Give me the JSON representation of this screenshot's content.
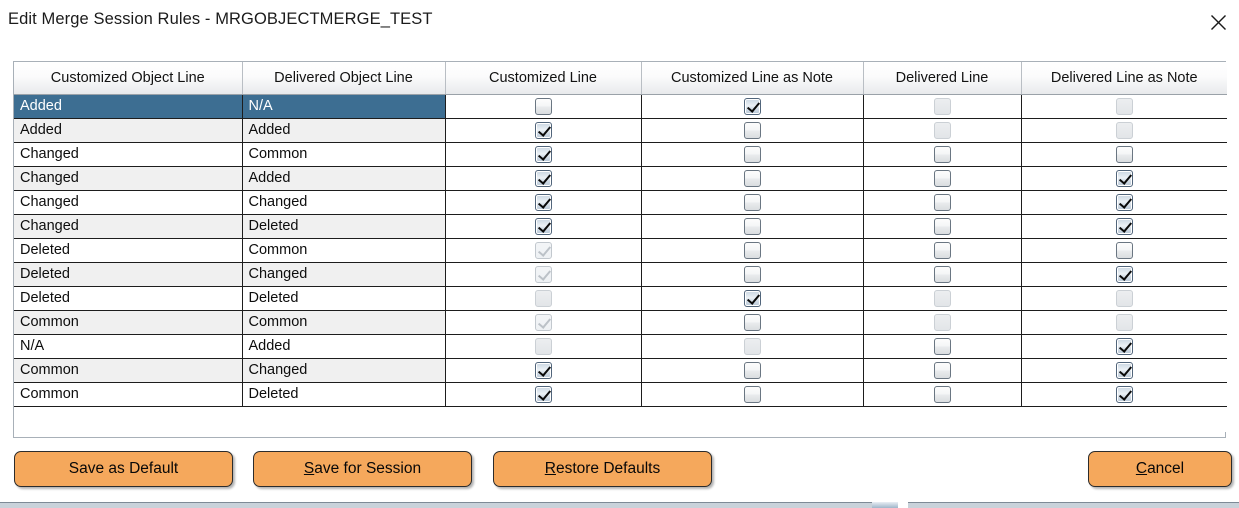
{
  "window": {
    "title": "Edit Merge Session Rules - MRGOBJECTMERGE_TEST",
    "close_label": "✕"
  },
  "table": {
    "columns": [
      "Customized Object Line",
      "Delivered Object Line",
      "Customized Line",
      "Customized Line as Note",
      "Delivered Line",
      "Delivered Line as Note"
    ],
    "rows": [
      {
        "customized_object_line": "Added",
        "delivered_object_line": "N/A",
        "customized_line": "off",
        "customized_line_as_note": "on",
        "delivered_line": "off-disabled",
        "delivered_line_as_note": "off-disabled",
        "selected": true
      },
      {
        "customized_object_line": "Added",
        "delivered_object_line": "Added",
        "customized_line": "on",
        "customized_line_as_note": "off",
        "delivered_line": "off-disabled",
        "delivered_line_as_note": "off-disabled",
        "selected": false
      },
      {
        "customized_object_line": "Changed",
        "delivered_object_line": "Common",
        "customized_line": "on",
        "customized_line_as_note": "off",
        "delivered_line": "off",
        "delivered_line_as_note": "off",
        "selected": false
      },
      {
        "customized_object_line": "Changed",
        "delivered_object_line": "Added",
        "customized_line": "on",
        "customized_line_as_note": "off",
        "delivered_line": "off",
        "delivered_line_as_note": "on",
        "selected": false
      },
      {
        "customized_object_line": "Changed",
        "delivered_object_line": "Changed",
        "customized_line": "on",
        "customized_line_as_note": "off",
        "delivered_line": "off",
        "delivered_line_as_note": "on",
        "selected": false
      },
      {
        "customized_object_line": "Changed",
        "delivered_object_line": "Deleted",
        "customized_line": "on",
        "customized_line_as_note": "off",
        "delivered_line": "off",
        "delivered_line_as_note": "on",
        "selected": false
      },
      {
        "customized_object_line": "Deleted",
        "delivered_object_line": "Common",
        "customized_line": "on-disabled",
        "customized_line_as_note": "off",
        "delivered_line": "off",
        "delivered_line_as_note": "off",
        "selected": false
      },
      {
        "customized_object_line": "Deleted",
        "delivered_object_line": "Changed",
        "customized_line": "on-disabled",
        "customized_line_as_note": "off",
        "delivered_line": "off",
        "delivered_line_as_note": "on",
        "selected": false
      },
      {
        "customized_object_line": "Deleted",
        "delivered_object_line": "Deleted",
        "customized_line": "off-disabled",
        "customized_line_as_note": "on",
        "delivered_line": "off-disabled",
        "delivered_line_as_note": "off-disabled",
        "selected": false
      },
      {
        "customized_object_line": "Common",
        "delivered_object_line": "Common",
        "customized_line": "on-disabled",
        "customized_line_as_note": "off",
        "delivered_line": "off-disabled",
        "delivered_line_as_note": "off-disabled",
        "selected": false
      },
      {
        "customized_object_line": "N/A",
        "delivered_object_line": "Added",
        "customized_line": "off-disabled",
        "customized_line_as_note": "off-disabled",
        "delivered_line": "off",
        "delivered_line_as_note": "on",
        "selected": false
      },
      {
        "customized_object_line": "Common",
        "delivered_object_line": "Changed",
        "customized_line": "on",
        "customized_line_as_note": "off",
        "delivered_line": "off",
        "delivered_line_as_note": "on",
        "selected": false
      },
      {
        "customized_object_line": "Common",
        "delivered_object_line": "Deleted",
        "customized_line": "on",
        "customized_line_as_note": "off",
        "delivered_line": "off",
        "delivered_line_as_note": "on",
        "selected": false
      }
    ]
  },
  "buttons": {
    "save_as_default": {
      "text": "Save as Default",
      "mnemonic_index": -1
    },
    "save_for_session": {
      "text": "Save for Session",
      "mnemonic_index": 0
    },
    "restore_defaults": {
      "text": "Restore Defaults",
      "mnemonic_index": 0
    },
    "cancel": {
      "text": "Cancel",
      "mnemonic_index": 0
    }
  },
  "colors": {
    "button_background": "#f5a85c",
    "selected_row": "#3d6e92",
    "alt_row": "#f0f0f0",
    "header_gradient_end": "#e8eaec"
  }
}
